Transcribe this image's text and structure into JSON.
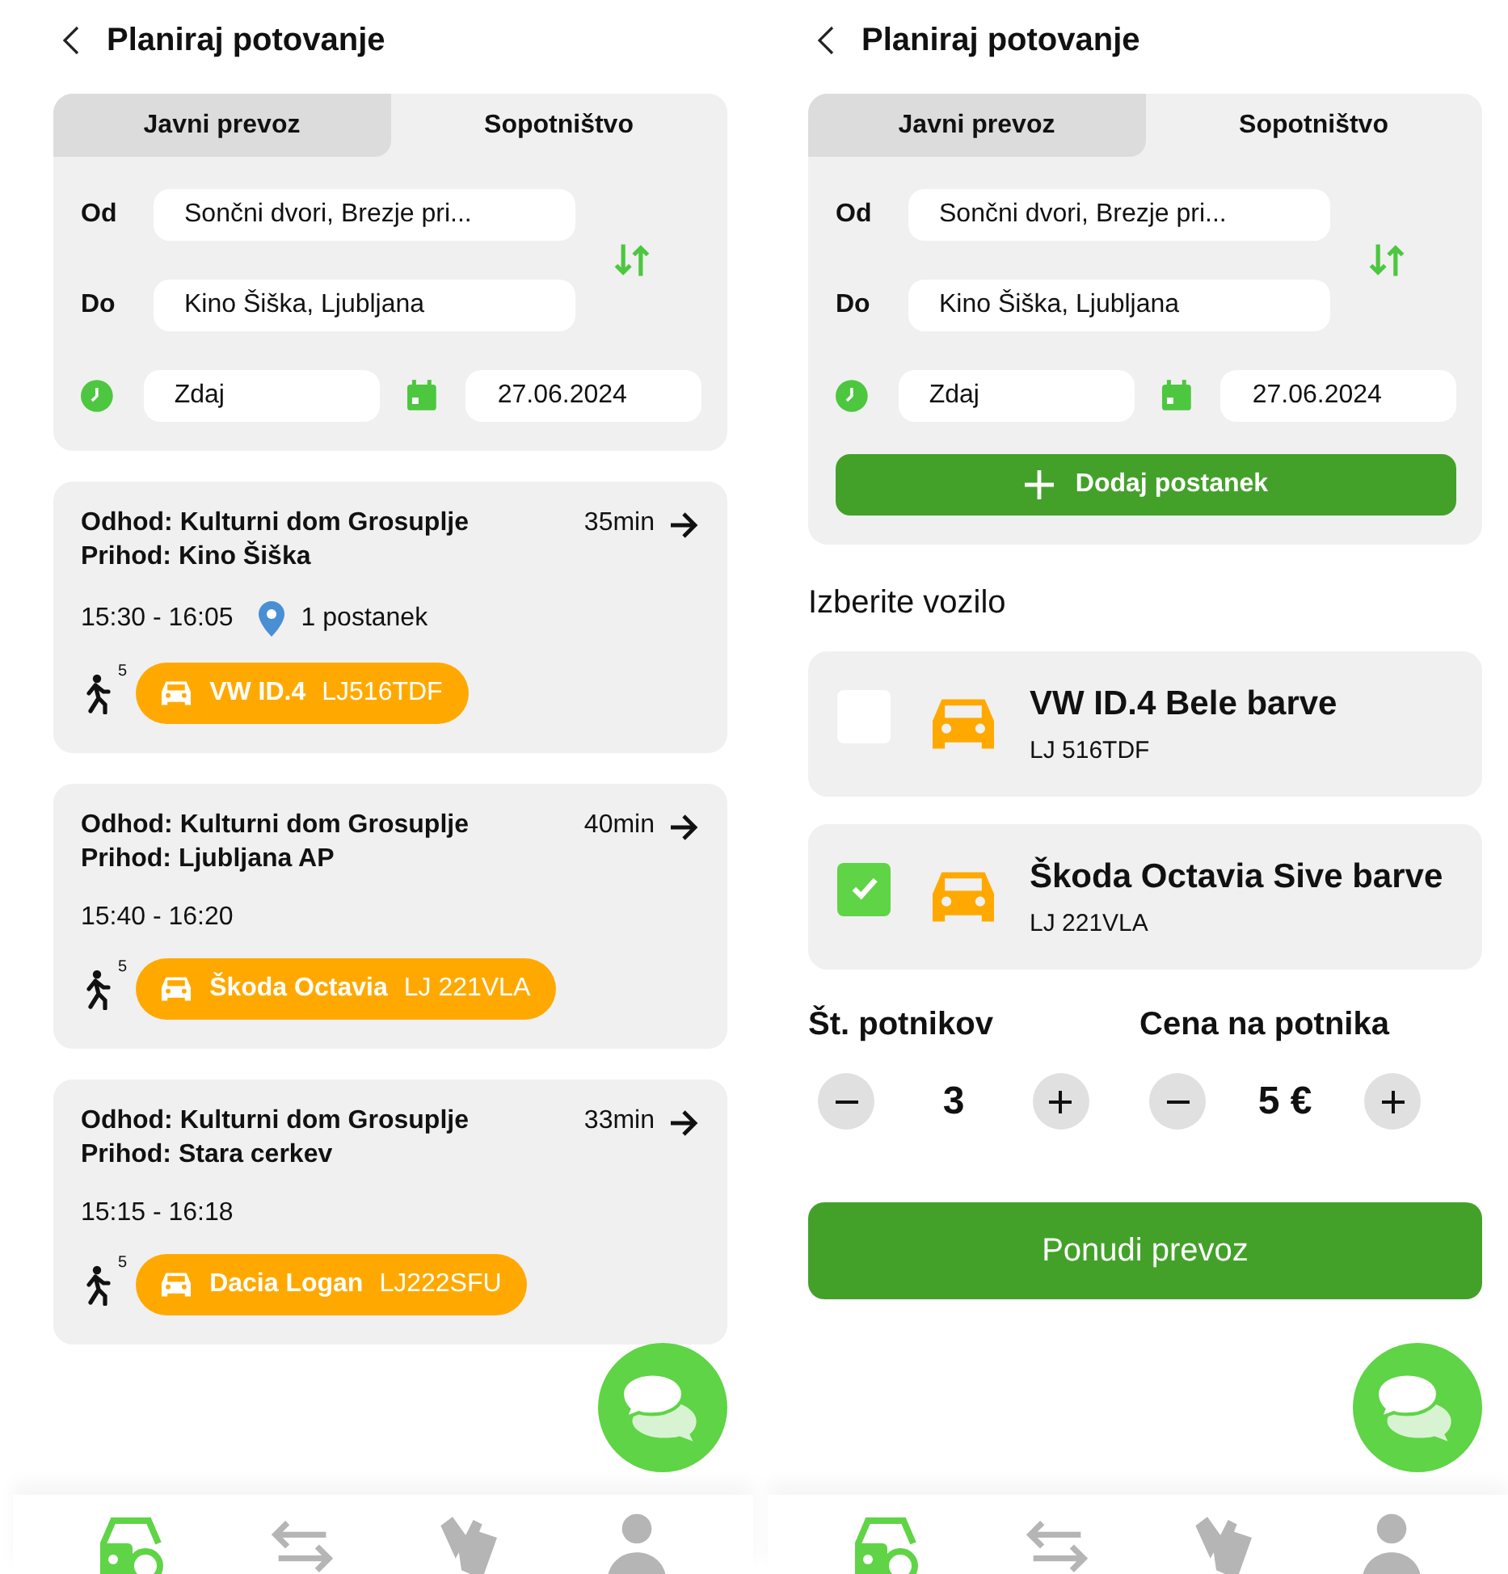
{
  "screens": [
    {
      "kind": "results",
      "title": "Planiraj potovanje",
      "tabs": [
        {
          "label": "Javni prevoz",
          "selected": false
        },
        {
          "label": "Sopotništvo",
          "selected": true
        }
      ],
      "from_label": "Od",
      "from": "Sončni dvori, Brezje pri...",
      "to_label": "Do",
      "to": "Kino Šiška, Ljubljana",
      "time": "Zdaj",
      "date": "27.06.2024",
      "trips": [
        {
          "departure": "Odhod: Kulturni dom Grosuplje",
          "arrival": "Prihod: Kino Šiška",
          "duration": "35min",
          "times": "15:30 - 16:05",
          "stops": "1 postanek",
          "walk": "5",
          "car": "VW ID.4",
          "plate": "LJ516TDF"
        },
        {
          "departure": "Odhod: Kulturni dom Grosuplje",
          "arrival": "Prihod: Ljubljana AP",
          "duration": "40min",
          "times": "15:40 - 16:20",
          "walk": "5",
          "car": "Škoda Octavia",
          "plate": "LJ 221VLA"
        },
        {
          "departure": "Odhod: Kulturni dom Grosuplje",
          "arrival": "Prihod: Stara cerkev",
          "duration": "33min",
          "times": "15:15 - 16:18",
          "walk": "5",
          "car": "Dacia Logan",
          "plate": "LJ222SFU"
        }
      ],
      "nav": [
        {
          "kind": "search",
          "selected": true
        },
        {
          "kind": "swap",
          "selected": false
        },
        {
          "kind": "tickets",
          "selected": false
        },
        {
          "kind": "profile",
          "selected": false
        }
      ]
    },
    {
      "kind": "offer",
      "title": "Planiraj potovanje",
      "tabs": [
        {
          "label": "Javni prevoz",
          "selected": false
        },
        {
          "label": "Sopotništvo",
          "selected": true
        }
      ],
      "from_label": "Od",
      "from": "Sončni dvori, Brezje pri...",
      "to_label": "Do",
      "to": "Kino Šiška, Ljubljana",
      "time": "Zdaj",
      "date": "27.06.2024",
      "add_stop": "Dodaj postanek",
      "vehicle_heading": "Izberite vozilo",
      "vehicles": [
        {
          "name": "VW ID.4 Bele barve",
          "plate": "LJ 516TDF",
          "checked": false
        },
        {
          "name": "Škoda Octavia Sive barve",
          "plate": "LJ 221VLA",
          "checked": true
        }
      ],
      "steppers": [
        {
          "label": "Št. potnikov",
          "value": "3"
        },
        {
          "label": "Cena na potnika",
          "value": "5 €"
        }
      ],
      "submit": "Ponudi prevoz",
      "nav": [
        {
          "kind": "search",
          "selected": true
        },
        {
          "kind": "swap",
          "selected": false
        },
        {
          "kind": "tickets",
          "selected": false
        },
        {
          "kind": "profile",
          "selected": false
        }
      ]
    }
  ]
}
